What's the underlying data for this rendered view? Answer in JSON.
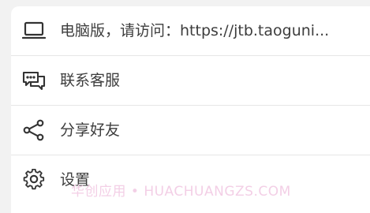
{
  "menu": {
    "items": [
      {
        "icon": "laptop-icon",
        "label": "电脑版，请访问：https://jtb.taoguni..."
      },
      {
        "icon": "chat-bubbles-icon",
        "label": "联系客服"
      },
      {
        "icon": "share-icon",
        "label": "分享好友"
      },
      {
        "icon": "gear-icon",
        "label": "设置"
      }
    ]
  },
  "watermark": {
    "text": "华创应用 • HUACHUANGZS.COM"
  },
  "colors": {
    "background": "#f2f2f2",
    "card": "#ffffff",
    "text": "#3d3d3d",
    "icon": "#333333",
    "divider": "#e6e6e6",
    "watermark": "#f3cfe6"
  }
}
